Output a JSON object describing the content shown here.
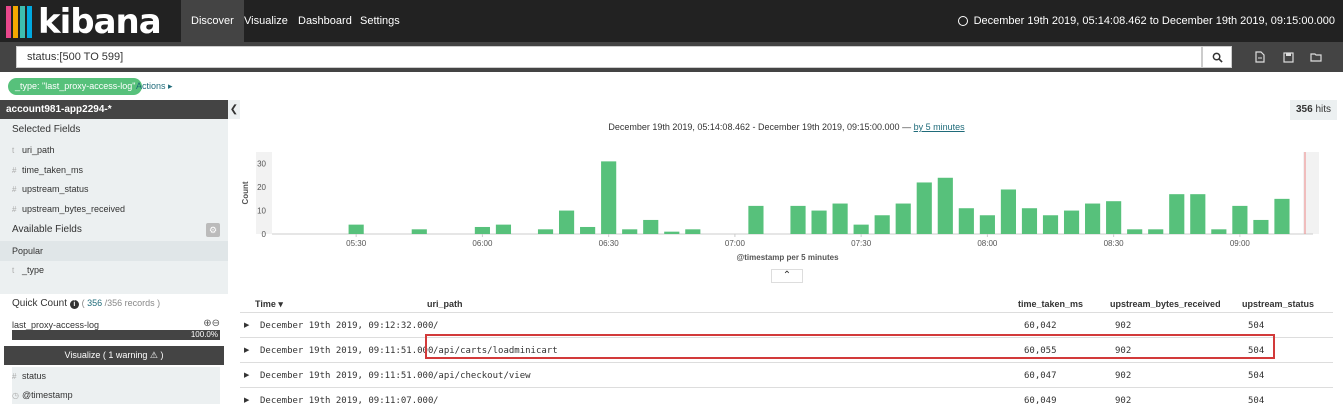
{
  "nav": {
    "logo_text": "kibana",
    "logo_colors": [
      "#e8478b",
      "#f5a800",
      "#3ebeb0",
      "#00a9e0"
    ],
    "tabs": [
      {
        "label": "Discover",
        "active": true
      },
      {
        "label": "Visualize",
        "active": false
      },
      {
        "label": "Dashboard",
        "active": false
      },
      {
        "label": "Settings",
        "active": false
      }
    ],
    "time_range": "December 19th 2019, 05:14:08.462 to December 19th 2019, 09:15:00.000"
  },
  "query": {
    "value": "status:[500 TO 599]",
    "icons": [
      "search-icon",
      "new-search-icon",
      "save-icon",
      "open-icon"
    ]
  },
  "filter": {
    "pill": "_type: \"last_proxy-access-log\"",
    "actions": "Actions ▸"
  },
  "sidebar": {
    "index_pattern": "account981-app2294-*",
    "selected_title": "Selected Fields",
    "selected_fields": [
      {
        "type": "t",
        "name": "uri_path"
      },
      {
        "type": "#",
        "name": "time_taken_ms"
      },
      {
        "type": "#",
        "name": "upstream_status"
      },
      {
        "type": "#",
        "name": "upstream_bytes_received"
      }
    ],
    "available_title": "Available Fields",
    "popular_label": "Popular",
    "popular_fields": [
      {
        "type": "t",
        "name": "_type"
      }
    ],
    "quick_count": {
      "title": "Quick Count",
      "count": "356",
      "total": "/356 records",
      "value_label": "last_proxy-access-log",
      "percent": "100.0%",
      "fill_fraction": 1.0,
      "visualize_label": "Visualize ( 1 warning ⚠ )"
    },
    "more_fields": [
      {
        "type": "#",
        "name": "status"
      },
      {
        "type": "◷",
        "name": "@timestamp"
      }
    ]
  },
  "main": {
    "hits": "356",
    "hits_label": "hits",
    "chart_range": "December 19th 2019, 05:14:08.462 - December 19th 2019, 09:15:00.000 —",
    "chart_interval": "by 5 minutes",
    "expand_symbol": "⌃"
  },
  "chart_data": {
    "type": "bar",
    "xlabel": "@timestamp per 5 minutes",
    "ylabel": "Count",
    "ylim": [
      0,
      35
    ],
    "yticks": [
      0,
      10,
      20,
      30
    ],
    "xticks": [
      "05:30",
      "06:00",
      "06:30",
      "07:00",
      "07:30",
      "08:00",
      "08:30",
      "09:00"
    ],
    "x_start": "05:10",
    "x_end": "09:15",
    "bar_color": "#57c17b",
    "bars": [
      {
        "t": "05:30",
        "v": 4
      },
      {
        "t": "05:45",
        "v": 2
      },
      {
        "t": "06:00",
        "v": 3
      },
      {
        "t": "06:05",
        "v": 4
      },
      {
        "t": "06:15",
        "v": 2
      },
      {
        "t": "06:20",
        "v": 10
      },
      {
        "t": "06:25",
        "v": 3
      },
      {
        "t": "06:30",
        "v": 31
      },
      {
        "t": "06:35",
        "v": 2
      },
      {
        "t": "06:40",
        "v": 6
      },
      {
        "t": "06:45",
        "v": 1
      },
      {
        "t": "06:50",
        "v": 2
      },
      {
        "t": "07:05",
        "v": 12
      },
      {
        "t": "07:15",
        "v": 12
      },
      {
        "t": "07:20",
        "v": 10
      },
      {
        "t": "07:25",
        "v": 13
      },
      {
        "t": "07:30",
        "v": 4
      },
      {
        "t": "07:35",
        "v": 8
      },
      {
        "t": "07:40",
        "v": 13
      },
      {
        "t": "07:45",
        "v": 22
      },
      {
        "t": "07:50",
        "v": 24
      },
      {
        "t": "07:55",
        "v": 11
      },
      {
        "t": "08:00",
        "v": 8
      },
      {
        "t": "08:05",
        "v": 19
      },
      {
        "t": "08:10",
        "v": 11
      },
      {
        "t": "08:15",
        "v": 8
      },
      {
        "t": "08:20",
        "v": 10
      },
      {
        "t": "08:25",
        "v": 13
      },
      {
        "t": "08:30",
        "v": 14
      },
      {
        "t": "08:35",
        "v": 2
      },
      {
        "t": "08:40",
        "v": 2
      },
      {
        "t": "08:45",
        "v": 17
      },
      {
        "t": "08:50",
        "v": 17
      },
      {
        "t": "08:55",
        "v": 2
      },
      {
        "t": "09:00",
        "v": 12
      },
      {
        "t": "09:05",
        "v": 6
      },
      {
        "t": "09:10",
        "v": 15
      }
    ]
  },
  "table": {
    "columns": [
      "Time",
      "uri_path",
      "time_taken_ms",
      "upstream_bytes_received",
      "upstream_status"
    ],
    "sort_indicator": "▾",
    "rows": [
      {
        "time": "December 19th 2019, 09:12:32.000",
        "uri_path": "/",
        "time_taken_ms": "60,042",
        "bytes": "902",
        "status": "504"
      },
      {
        "time": "December 19th 2019, 09:11:51.000",
        "uri_path": "/api/carts/loadminicart",
        "time_taken_ms": "60,055",
        "bytes": "902",
        "status": "504"
      },
      {
        "time": "December 19th 2019, 09:11:51.000",
        "uri_path": "/api/checkout/view",
        "time_taken_ms": "60,047",
        "bytes": "902",
        "status": "504"
      },
      {
        "time": "December 19th 2019, 09:11:07.000",
        "uri_path": "/",
        "time_taken_ms": "60,049",
        "bytes": "902",
        "status": "504"
      }
    ],
    "highlighted_row": 1,
    "highlight_color": "#d23a3a"
  }
}
